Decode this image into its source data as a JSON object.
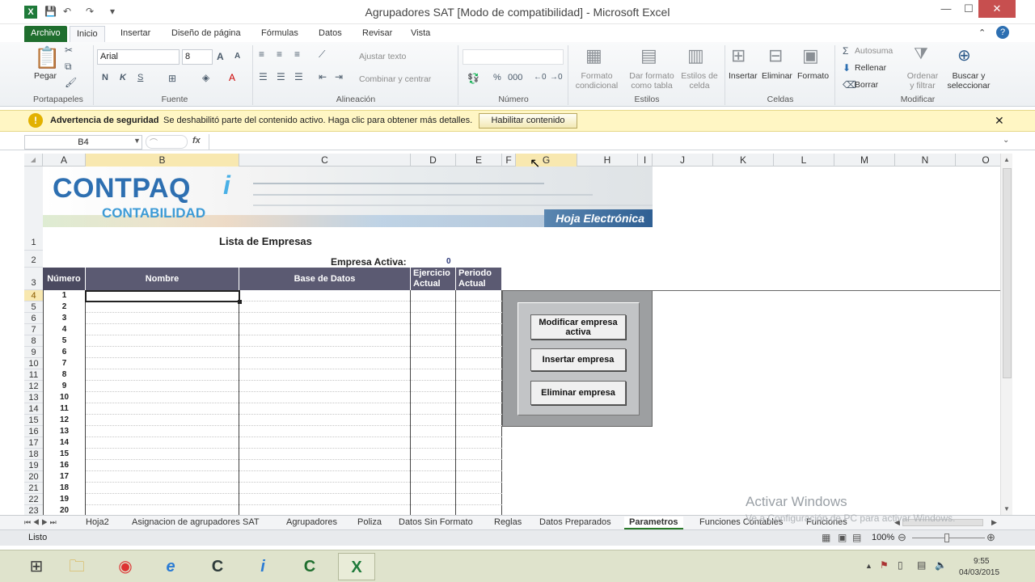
{
  "window": {
    "title": "Agrupadores SAT  [Modo de compatibilidad] - Microsoft Excel",
    "min": "—",
    "max": "☐",
    "close": "✕"
  },
  "ribbon_tabs": [
    "Archivo",
    "Inicio",
    "Insertar",
    "Diseño de página",
    "Fórmulas",
    "Datos",
    "Revisar",
    "Vista"
  ],
  "ribbon": {
    "paste": "Pegar",
    "portapapeles": "Portapapeles",
    "font_name": "Arial",
    "font_size": "8",
    "fuente": "Fuente",
    "ajustar_texto": "Ajustar texto",
    "combinar": "Combinar y centrar",
    "alineacion": "Alineación",
    "numero": "Número",
    "formato_condicional": "Formato condicional",
    "dar_formato": "Dar formato como tabla",
    "estilos_celda": "Estilos de celda",
    "estilos": "Estilos",
    "insertar": "Insertar",
    "eliminar": "Eliminar",
    "formato": "Formato",
    "celdas": "Celdas",
    "autosuma": "Autosuma",
    "rellenar": "Rellenar",
    "borrar": "Borrar",
    "ordenar": "Ordenar y filtrar",
    "buscar": "Buscar y seleccionar",
    "modificar": "Modificar"
  },
  "security": {
    "title": "Advertencia de seguridad",
    "message": "Se deshabilitó parte del contenido activo. Haga clic para obtener más detalles.",
    "button": "Habilitar contenido"
  },
  "formula": {
    "namebox": "B4",
    "fx": "fx",
    "content": ""
  },
  "columns": [
    "A",
    "B",
    "C",
    "D",
    "E",
    "F",
    "G",
    "H",
    "I",
    "J",
    "K",
    "L",
    "M",
    "N",
    "O"
  ],
  "banner": {
    "brand": "CONTPAQ",
    "brand_i": "i",
    "product": "CONTABILIDAD",
    "hoja": "Hoja Electrónica"
  },
  "sheet": {
    "list_title": "Lista de Empresas",
    "empresa_activa_label": "Empresa Activa:",
    "empresa_activa_value": "0",
    "headers": [
      "Número",
      "Nombre",
      "Base de Datos",
      "Ejercicio Actual",
      "Periodo Actual"
    ],
    "row_labels": [
      "1",
      "2",
      "3",
      "4",
      "5",
      "6",
      "7",
      "8",
      "9",
      "10",
      "11",
      "12",
      "13",
      "14",
      "15",
      "16",
      "17",
      "18",
      "19",
      "20",
      "21",
      "22",
      "23"
    ],
    "numbers": [
      "1",
      "2",
      "3",
      "4",
      "5",
      "6",
      "7",
      "8",
      "9",
      "10",
      "11",
      "12",
      "13",
      "14",
      "15",
      "16",
      "17",
      "18",
      "19",
      "20"
    ]
  },
  "panel": {
    "btn_modificar": "Modificar empresa activa",
    "btn_insertar": "Insertar empresa",
    "btn_eliminar": "Eliminar empresa"
  },
  "sheet_tabs": [
    "Hoja2",
    "Asignacion de agrupadores SAT",
    "Agrupadores",
    "Poliza",
    "Datos Sin Formato",
    "Reglas",
    "Datos Preparados",
    "Parametros",
    "Funciones Contables",
    "Funciones Bancarias"
  ],
  "active_sheet": "Parametros",
  "status": {
    "ready": "Listo",
    "zoom": "100%"
  },
  "watermark": {
    "line1": "Activar Windows",
    "line2": "Ve a Configuración de PC para activar Windows."
  },
  "taskbar": {
    "time": "9:55",
    "date": "04/03/2015"
  }
}
